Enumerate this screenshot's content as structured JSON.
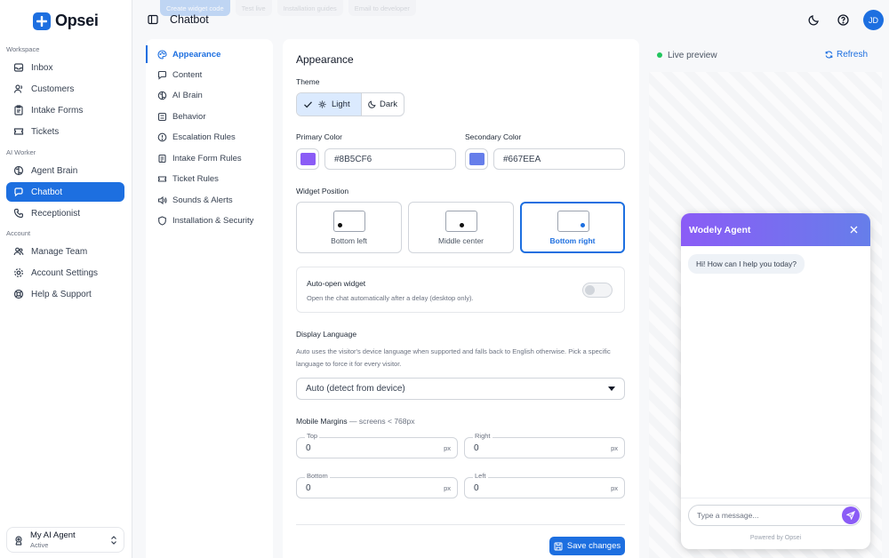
{
  "app": {
    "name": "Opsei"
  },
  "sidebar": {
    "sections": [
      {
        "label": "Workspace",
        "items": [
          {
            "label": "Inbox",
            "icon": "inbox-icon"
          },
          {
            "label": "Customers",
            "icon": "users-icon"
          },
          {
            "label": "Intake Forms",
            "icon": "clipboard-icon"
          },
          {
            "label": "Tickets",
            "icon": "ticket-icon"
          }
        ]
      },
      {
        "label": "AI Worker",
        "items": [
          {
            "label": "Agent Brain",
            "icon": "brain-icon"
          },
          {
            "label": "Chatbot",
            "icon": "chat-icon",
            "active": true
          },
          {
            "label": "Receptionist",
            "icon": "phone-icon"
          }
        ]
      },
      {
        "label": "Account",
        "items": [
          {
            "label": "Manage Team",
            "icon": "team-icon"
          },
          {
            "label": "Account Settings",
            "icon": "gear-icon"
          },
          {
            "label": "Help & Support",
            "icon": "help-icon"
          }
        ]
      }
    ],
    "agent": {
      "name": "My AI Agent",
      "status": "Active"
    }
  },
  "header": {
    "title": "Chatbot",
    "user_initials": "JD",
    "ghost_buttons": [
      "Create widget code",
      "Test live",
      "Installation guides",
      "Email to developer"
    ]
  },
  "subnav": {
    "items": [
      {
        "label": "Appearance",
        "icon": "palette-icon",
        "active": true
      },
      {
        "label": "Content",
        "icon": "chat-bubble-icon"
      },
      {
        "label": "AI Brain",
        "icon": "brain-icon"
      },
      {
        "label": "Behavior",
        "icon": "sliders-icon"
      },
      {
        "label": "Escalation Rules",
        "icon": "alert-icon"
      },
      {
        "label": "Intake Form Rules",
        "icon": "form-icon"
      },
      {
        "label": "Ticket Rules",
        "icon": "ticket-icon"
      },
      {
        "label": "Sounds & Alerts",
        "icon": "speaker-icon"
      },
      {
        "label": "Installation & Security",
        "icon": "shield-icon"
      }
    ]
  },
  "appearance": {
    "title": "Appearance",
    "theme": {
      "label": "Theme",
      "options": [
        "Light",
        "Dark"
      ],
      "selected": "Light"
    },
    "primary_color": {
      "label": "Primary Color",
      "value": "#8B5CF6"
    },
    "secondary_color": {
      "label": "Secondary Color",
      "value": "#667EEA"
    },
    "widget_position": {
      "label": "Widget Position",
      "options": [
        "Bottom left",
        "Middle center",
        "Bottom right"
      ],
      "selected": "Bottom right"
    },
    "auto_open": {
      "title": "Auto-open widget",
      "description": "Open the chat automatically after a delay (desktop only).",
      "enabled": false
    },
    "display_language": {
      "label": "Display Language",
      "description": "Auto uses the visitor's device language when supported and falls back to English otherwise. Pick a specific language to force it for every visitor.",
      "selected": "Auto (detect from device)"
    },
    "mobile_margins": {
      "label": "Mobile Margins",
      "note": "— screens < 768px",
      "unit": "px",
      "top": {
        "label": "Top",
        "value": "0"
      },
      "right": {
        "label": "Right",
        "value": "0"
      },
      "bottom": {
        "label": "Bottom",
        "value": "0"
      },
      "left": {
        "label": "Left",
        "value": "0"
      }
    },
    "save_label": "Save changes"
  },
  "preview": {
    "status": "Live preview",
    "refresh_label": "Refresh",
    "widget": {
      "title": "Wodely Agent",
      "greeting": "Hi! How can I help you today?",
      "input_placeholder": "Type a message...",
      "footer": "Powered by Opsei"
    }
  },
  "colors": {
    "accent": "#1d6fe0",
    "primary": "#8B5CF6",
    "secondary": "#667EEA",
    "live": "#22c55e"
  }
}
